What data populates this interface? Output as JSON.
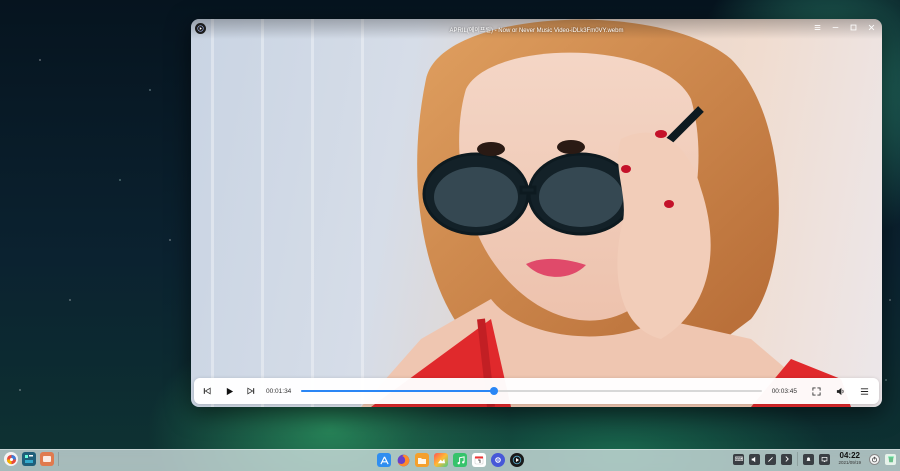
{
  "window": {
    "title": "APRIL(에이프릴) - Now or Never Music Video-iDLk3Fm0VY.webm"
  },
  "player": {
    "elapsed": "00:01:34",
    "duration": "00:03:45",
    "progress": 0.418
  },
  "clock": {
    "time": "04:22",
    "date": "2021/09/19"
  },
  "colors": {
    "accent": "#2a86f5",
    "taskbar": "#d2e1e1"
  },
  "icons": {
    "app_logo": "movie-logo-icon",
    "prev": "skip-previous-icon",
    "play": "play-icon",
    "next": "skip-next-icon",
    "fullscreen": "fullscreen-icon",
    "volume": "volume-icon",
    "playlist": "playlist-icon"
  }
}
